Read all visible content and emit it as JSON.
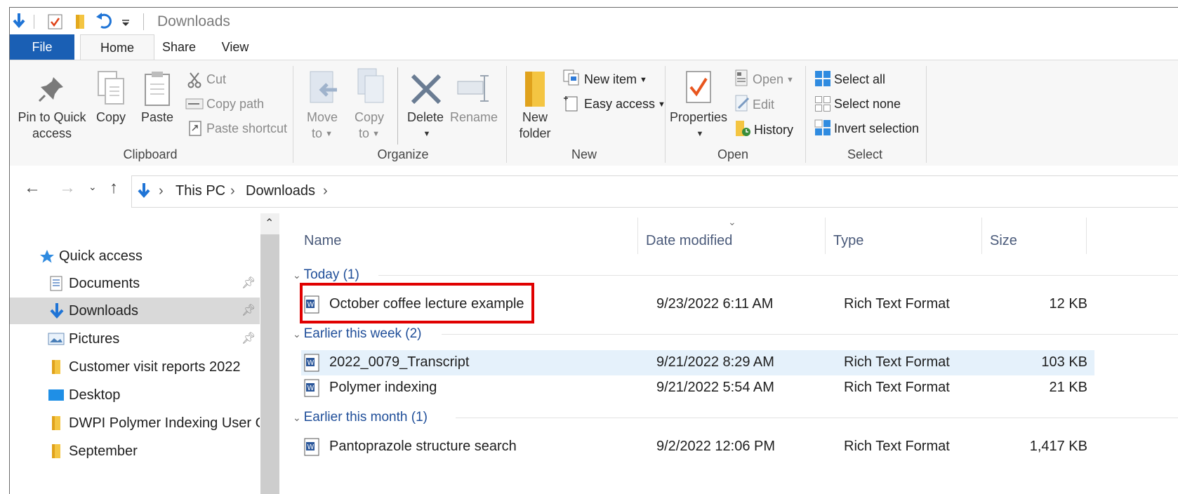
{
  "window": {
    "title": "Downloads"
  },
  "tabs": [
    {
      "label": "File"
    },
    {
      "label": "Home"
    },
    {
      "label": "Share"
    },
    {
      "label": "View"
    }
  ],
  "ribbon": {
    "clipboard": {
      "label": "Clipboard",
      "pin_line1": "Pin to Quick",
      "pin_line2": "access",
      "copy": "Copy",
      "paste": "Paste",
      "cut": "Cut",
      "copy_path": "Copy path",
      "paste_shortcut": "Paste shortcut"
    },
    "organize": {
      "label": "Organize",
      "move_line1": "Move",
      "move_line2": "to",
      "copyto_line1": "Copy",
      "copyto_line2": "to",
      "delete": "Delete",
      "rename": "Rename"
    },
    "new": {
      "label": "New",
      "new_folder_line1": "New",
      "new_folder_line2": "folder",
      "new_item": "New item",
      "easy_access": "Easy access"
    },
    "open": {
      "label": "Open",
      "properties": "Properties",
      "open": "Open",
      "edit": "Edit",
      "history": "History"
    },
    "select": {
      "label": "Select",
      "select_all": "Select all",
      "select_none": "Select none",
      "invert": "Invert selection"
    }
  },
  "address": {
    "crumbs": [
      "This PC",
      "Downloads"
    ]
  },
  "nav": {
    "items": [
      {
        "label": "Quick access"
      },
      {
        "label": "Documents"
      },
      {
        "label": "Downloads"
      },
      {
        "label": "Pictures"
      },
      {
        "label": "Customer visit reports 2022"
      },
      {
        "label": "Desktop"
      },
      {
        "label": "DWPI Polymer Indexing User Gu"
      },
      {
        "label": "September"
      }
    ]
  },
  "columns": {
    "name": "Name",
    "date": "Date modified",
    "type": "Type",
    "size": "Size"
  },
  "groups": [
    {
      "label": "Today (1)",
      "files": [
        {
          "name": "October coffee lecture example",
          "date": "9/23/2022 6:11 AM",
          "type": "Rich Text Format",
          "size": "12 KB"
        }
      ]
    },
    {
      "label": "Earlier this week (2)",
      "files": [
        {
          "name": "2022_0079_Transcript",
          "date": "9/21/2022 8:29 AM",
          "type": "Rich Text Format",
          "size": "103 KB"
        },
        {
          "name": "Polymer indexing",
          "date": "9/21/2022 5:54 AM",
          "type": "Rich Text Format",
          "size": "21 KB"
        }
      ]
    },
    {
      "label": "Earlier this month (1)",
      "files": [
        {
          "name": "Pantoprazole structure search",
          "date": "9/2/2022 12:06 PM",
          "type": "Rich Text Format",
          "size": "1,417 KB"
        }
      ]
    }
  ],
  "colors": {
    "accent": "#1a5fb4",
    "highlight": "#e5f1fb",
    "annotation": "#e00000"
  }
}
